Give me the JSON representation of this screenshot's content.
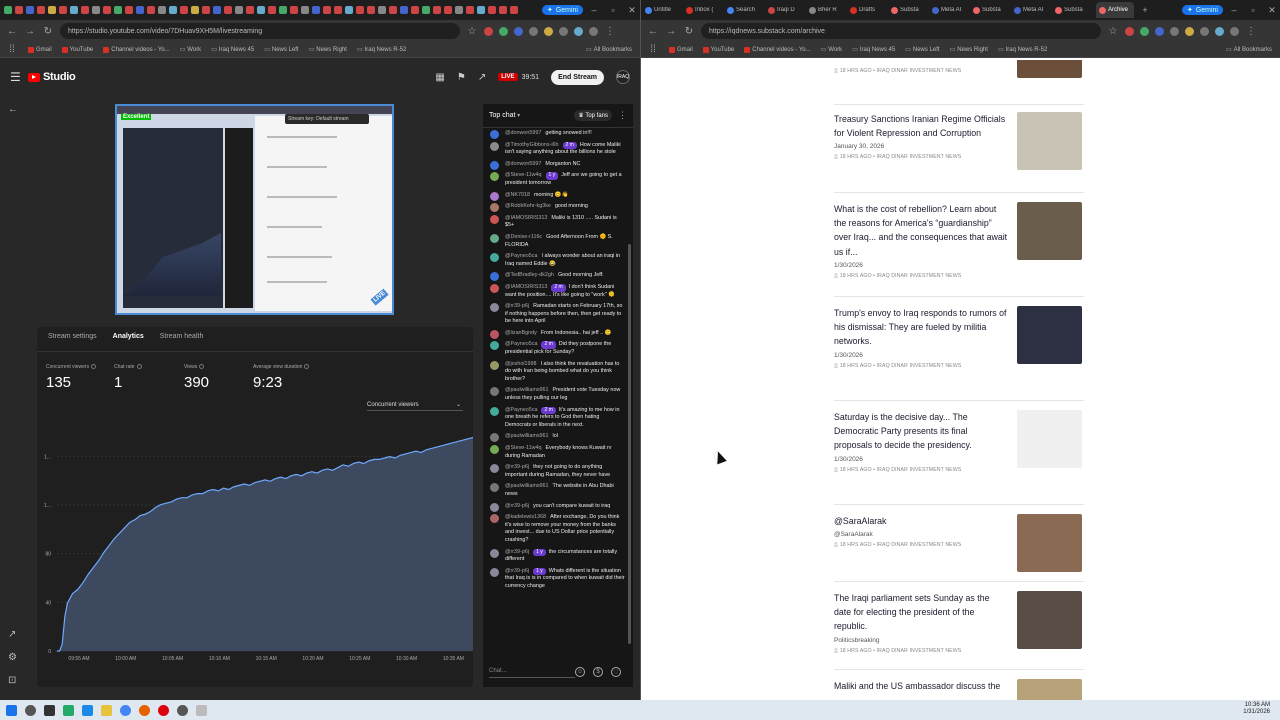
{
  "left_browser": {
    "active_tab": "YouTube Studio",
    "gemini": "Gemini",
    "url": "https://studio.youtube.com/video/7DHuav9XH5M/livestreaming",
    "bookmarks": [
      "Gmail",
      "YouTube",
      "Channel videos - Yo...",
      "Work",
      "Iraq News 45",
      "News Left",
      "News Right",
      "Iraq News R-52"
    ],
    "all_bookmarks": "All Bookmarks"
  },
  "studio": {
    "logo_text": "Studio",
    "live_label": "LIVE",
    "live_time": "39:51",
    "end_stream": "End Stream",
    "avatar_text": "IRAQ",
    "preview": {
      "quality": "Excellent",
      "stream_key": "Stream key: Default stream"
    },
    "tabs": [
      "Stream settings",
      "Analytics",
      "Stream health"
    ],
    "metrics": [
      {
        "label": "Concurrent viewers",
        "value": "135"
      },
      {
        "label": "Chat rate",
        "value": "1"
      },
      {
        "label": "Views",
        "value": "390"
      },
      {
        "label": "Average view duration",
        "value": "9:23"
      }
    ],
    "dropdown": "Concurrent viewers"
  },
  "chart_data": {
    "type": "area",
    "title": "",
    "xlabel": "",
    "ylabel": "",
    "y_ticks": [
      "0",
      "40",
      "80",
      "1...",
      "1..."
    ],
    "x_ticks": [
      "09:55 AM",
      "10:00 AM",
      "10:05 AM",
      "10:10 AM",
      "10:15 AM",
      "10:20 AM",
      "10:25 AM",
      "10:30 AM",
      "10:35 AM"
    ],
    "ylim": [
      0,
      160
    ],
    "x": [
      0,
      0.25,
      0.5,
      0.75,
      1,
      1.5,
      2,
      2.5,
      3,
      3.5,
      4,
      4.5,
      5,
      5.5,
      6,
      6.5,
      7,
      7.5,
      8,
      8.5,
      9,
      9.5,
      10,
      10.5,
      11,
      11.5,
      12,
      12.5,
      13,
      13.5,
      14,
      14.5,
      15,
      15.5,
      16,
      16.5,
      17,
      17.5,
      18,
      18.5,
      19,
      19.5,
      20,
      20.5,
      21,
      21.5,
      22,
      22.5,
      23,
      23.5,
      24,
      24.5,
      25,
      25.5,
      26,
      26.5,
      27,
      27.5,
      28,
      28.5,
      29,
      29.5,
      30,
      30.5,
      31,
      31.5,
      32,
      32.5,
      33,
      33.5,
      34,
      34.5,
      35,
      35.5,
      36,
      36.5,
      37,
      37.5,
      38,
      38.5,
      39,
      39.5,
      40
    ],
    "values": [
      0,
      0,
      5,
      25,
      35,
      42,
      45,
      50,
      56,
      61,
      66,
      72,
      77,
      82,
      86,
      90,
      94,
      96,
      99,
      100,
      102,
      105,
      107,
      108,
      109,
      111,
      112,
      112,
      114,
      115,
      115,
      117,
      118,
      117,
      119,
      118,
      120,
      121,
      122,
      121,
      123,
      124,
      125,
      124,
      126,
      127,
      126,
      128,
      129,
      128,
      130,
      131,
      130,
      132,
      133,
      132,
      134,
      136,
      135,
      137,
      138,
      137,
      139,
      140,
      140,
      141,
      142,
      141,
      143,
      144,
      145,
      146,
      145,
      147,
      148,
      149,
      150,
      151,
      152,
      153,
      154,
      155,
      156
    ]
  },
  "chat": {
    "title": "Top chat",
    "top_fans": "Top fans",
    "placeholder": "Chat...",
    "messages": [
      {
        "author": "@donwon5997",
        "text": "getting snowed in!!!",
        "color": "#3b6fd8"
      },
      {
        "author": "@TimothyGibbons-i6h",
        "badge": "2 m",
        "text": "How come Maliki isn't saying anything about the billions he stole",
        "color": "#8a8a8a"
      },
      {
        "author": "@donwon5997",
        "text": "Morganton NC",
        "color": "#3b6fd8"
      },
      {
        "author": "@Steve-11w4q",
        "badge": "1 y",
        "text": "Jeff are we going to get a president tomorrow",
        "color": "#7a5"
      },
      {
        "author": "@NK7018",
        "text": "morning 😊👋",
        "color": "#a7c"
      },
      {
        "author": "@RobbKehr-kg3ke",
        "text": "good morning",
        "color": "#a76"
      },
      {
        "author": "@IAMOSIRIS313",
        "text": "Maliki is 1310 ..... Sudani is $5+",
        "color": "#c55"
      },
      {
        "author": "@Denise-r116c",
        "text": "Good Afternoon From 🌞 S. FLORIDA",
        "color": "#6a8"
      },
      {
        "author": "@Payneo5ca",
        "text": "I always wonder about an iraqi in Iraq named Eddie 😂",
        "color": "#4a9"
      },
      {
        "author": "@TedBradley-dk2gh",
        "text": "Good morning Jeff.",
        "color": "#3b6fd8"
      },
      {
        "author": "@IAMOSIRIS313",
        "badge": "2 m",
        "text": "I don't think Sudani want the position.... It's like going to \"work\" 🫠",
        "color": "#c55"
      },
      {
        "author": "@rr39-p6j",
        "text": "Ramadan starts on February 17th, so if nothing happens before then, then get ready to be here into April",
        "color": "#889"
      },
      {
        "author": "@lizanBgndy",
        "text": "From Indonesia.. hai jeff .. 🙂",
        "color": "#b56"
      },
      {
        "author": "@Payneo5ca",
        "badge": "2 m",
        "text": "Did they postpone the presidential pick for Sunday?",
        "color": "#4a9"
      },
      {
        "author": "@joshol1998",
        "text": "I also think the revaluation has to do with Iran being bombed what do you think brother?",
        "color": "#996"
      },
      {
        "author": "@paulwilliams961",
        "text": "President vote Tuesday now unless they pulling our leg",
        "color": "#777"
      },
      {
        "author": "@Payneo5ca",
        "badge": "2 m",
        "text": "It's amazing to me how in one breath he refers to God then hating Democrats or liberals in the next.",
        "color": "#4a9"
      },
      {
        "author": "@paulwilliams961",
        "text": "lol",
        "color": "#777"
      },
      {
        "author": "@Steve-11w4q",
        "text": "Everybody knows Kuwait rv during Ramadan",
        "color": "#7a5"
      },
      {
        "author": "@rr39-p6j",
        "text": "they not going to do anything important during Ramadan, they never have",
        "color": "#889"
      },
      {
        "author": "@paulwilliams961",
        "text": "The website in Abu Dhabi news",
        "color": "#777"
      },
      {
        "author": "@rr39-p6j",
        "text": "you can't compare kuwait to iraq",
        "color": "#889"
      },
      {
        "author": "@kadelewis1368",
        "text": "After exchange, Do you think it's wise to remove your money from the banks and invest... due to US Dollar price potentially crashing?",
        "color": "#a66"
      },
      {
        "author": "@rr39-p6j",
        "badge": "1 y",
        "text": "the circumstances are totally different",
        "color": "#889"
      },
      {
        "author": "@rr39-p6j",
        "badge": "1 y",
        "text": "Whats different is the situation that Iraq is is in compared to when kuwait did their currency change",
        "color": "#889"
      }
    ]
  },
  "right_browser": {
    "tabs": [
      "Untitle",
      "Inbox (",
      "Search",
      "Iraqi D",
      "Bher R",
      "Drafts",
      "Substa",
      "Meta AI",
      "Substa",
      "Meta AI",
      "Substa",
      "Archive"
    ],
    "gemini": "Gemini",
    "url": "https://iqdnews.substack.com/archive",
    "bookmarks": [
      "Gmail",
      "YouTube",
      "Channel videos - Yo...",
      "Work",
      "Iraq News 45",
      "News Left",
      "News Right",
      "Iraq News R-52"
    ],
    "all_bookmarks": "All Bookmarks"
  },
  "news": {
    "top_meta": "18 HRS AGO • IRAQ DINAR INVESTMENT NEWS",
    "items": [
      {
        "title": "Treasury Sanctions Iranian Regime Officials for Violent Repression and Corruption",
        "date": "January 30, 2026",
        "meta": "18 HRS AGO • IRAQ DINAR INVESTMENT NEWS",
        "thumb": "#c9c3b6"
      },
      {
        "title": "What is the cost of rebellion? Learn about the reasons for America's “guardianship” over Iraq... and the consequences that await us if...",
        "date": "1/30/2026",
        "meta": "18 HRS AGO • IRAQ DINAR INVESTMENT NEWS",
        "thumb": "#6b5d4c"
      },
      {
        "title": "Trump's envoy to Iraq responds to rumors of his dismissal: They are fueled by militia networks.",
        "date": "1/30/2026",
        "meta": "18 HRS AGO • IRAQ DINAR INVESTMENT NEWS",
        "thumb": "#2c3042"
      },
      {
        "title": "Saturday is the decisive day... The Democratic Party presents its final proposals to decide the presidency.",
        "date": "1/30/2026",
        "meta": "18 HRS AGO • IRAQ DINAR INVESTMENT NEWS",
        "thumb": "#f0f0f0"
      },
      {
        "title": "@SaraAlarak",
        "date": "@SaraAlarak",
        "meta": "18 HRS AGO • IRAQ DINAR INVESTMENT NEWS",
        "thumb": "#8a6a52"
      },
      {
        "title": "The Iraqi parliament sets Sunday as the date for electing the president of the republic.",
        "date": "Politicsbreaking",
        "meta": "18 HRS AGO • IRAQ DINAR INVESTMENT NEWS",
        "thumb": "#5a4d45"
      },
      {
        "title": "Maliki and the US ambassador discuss the",
        "date": "",
        "meta": "",
        "thumb": "#b8a27a"
      }
    ]
  },
  "clock": {
    "time": "10:36 AM",
    "date": "1/31/2026"
  }
}
